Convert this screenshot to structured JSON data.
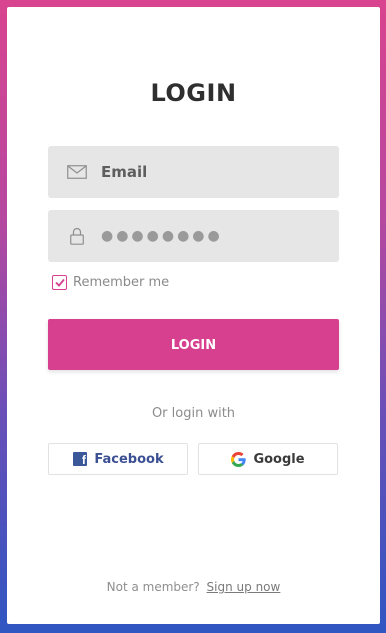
{
  "login": {
    "title": "LOGIN",
    "email_placeholder": "Email",
    "password_value": "●●●●●●●●",
    "remember_label": "Remember me",
    "remember_checked": true,
    "login_button": "LOGIN",
    "alt_login_text": "Or login with",
    "social": {
      "facebook_label": "Facebook",
      "google_label": "Google"
    },
    "footer": {
      "prompt": "Not a member?",
      "signup_link": "Sign up now"
    }
  },
  "icons": {
    "email": "envelope-icon",
    "password": "lock-icon",
    "checkbox": "check-icon",
    "facebook": "facebook-icon",
    "google": "google-icon"
  },
  "colors": {
    "accent": "#d6408e",
    "gradient_top": "#d9448f",
    "gradient_bottom": "#2f56c2",
    "facebook": "#3b5998"
  }
}
